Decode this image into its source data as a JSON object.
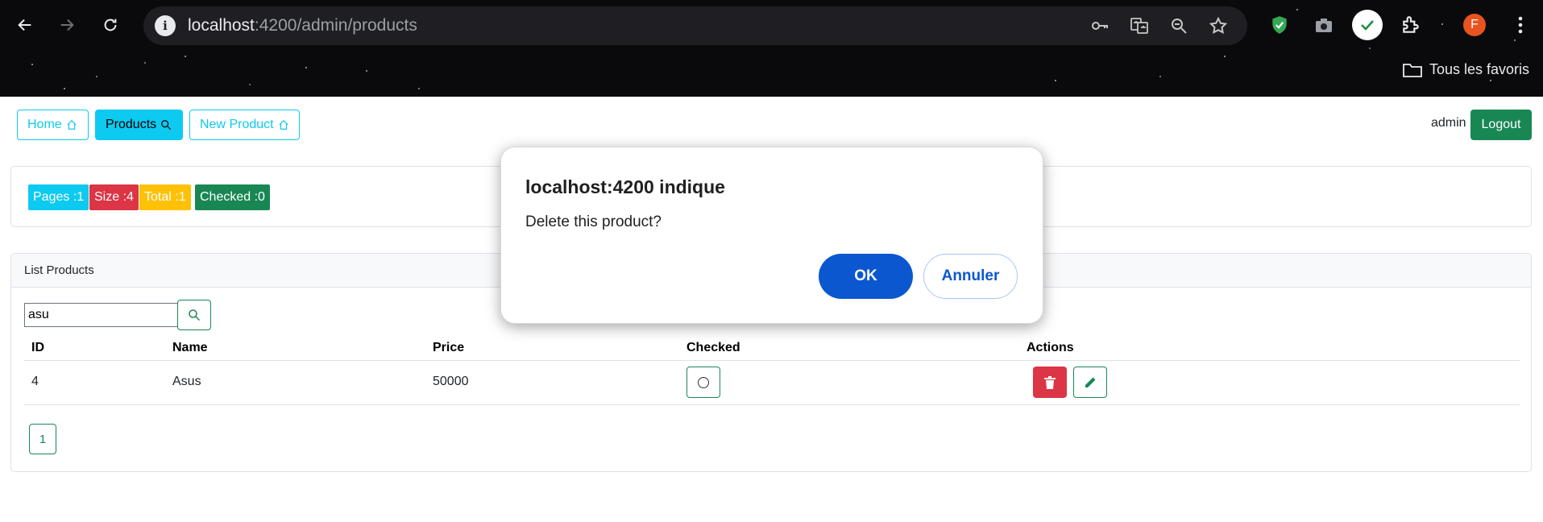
{
  "browser": {
    "url_host": "localhost",
    "url_path": ":4200/admin/products",
    "favorites_label": "Tous les favoris",
    "profile_initial": "F",
    "profile_color": "#e8531f"
  },
  "navbar": {
    "home_label": "Home",
    "products_label": "Products",
    "new_product_label": "New Product",
    "username": "admin",
    "logout_label": "Logout"
  },
  "stats": {
    "pages": "Pages :1",
    "size": "Size :4",
    "total": "Total :1",
    "checked": "Checked :0",
    "colors": {
      "pages": "#0dcaf0",
      "size": "#dc3545",
      "total": "#ffc107",
      "checked": "#198754"
    }
  },
  "product_list": {
    "title": "List Products",
    "search_value": "asu",
    "columns": [
      "ID",
      "Name",
      "Price",
      "Checked",
      "Actions"
    ],
    "rows": [
      {
        "id": "4",
        "name": "Asus",
        "price": "50000",
        "checked": false
      }
    ],
    "current_page": "1"
  },
  "dialog": {
    "title": "localhost:4200 indique",
    "message": "Delete this product?",
    "ok_label": "OK",
    "cancel_label": "Annuler"
  }
}
